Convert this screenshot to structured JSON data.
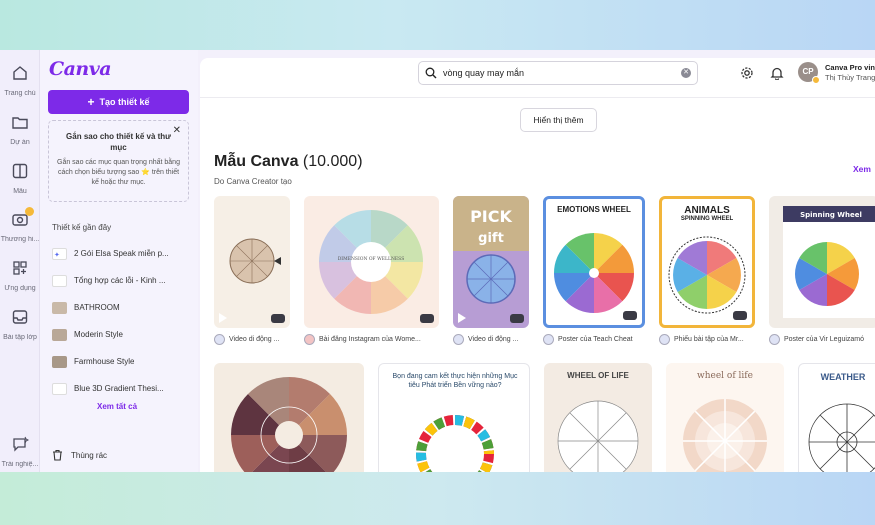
{
  "rail": [
    {
      "label": "Trang chủ",
      "icon": "home-icon"
    },
    {
      "label": "Dự án",
      "icon": "folder-icon"
    },
    {
      "label": "Mẫu",
      "icon": "template-icon"
    },
    {
      "label": "Thương hi...",
      "icon": "brand-icon"
    },
    {
      "label": "Ứng dụng",
      "icon": "apps-icon"
    },
    {
      "label": "Bài tập lớp",
      "icon": "classwork-icon"
    },
    {
      "label": "Trải nghiệ...",
      "icon": "dream-lab-icon"
    }
  ],
  "panel": {
    "logo": "Canva",
    "create_label": "Tạo thiết kế",
    "star_title": "Gắn sao cho thiết kế và thư mục",
    "star_body": "Gắn sao các mục quan trọng nhất bằng cách chọn biểu tượng sao ⭐ trên thiết kế hoặc thư mục.",
    "recent_title": "Thiết kế gần đây",
    "recent": [
      "2 Gói Elsa Speak miễn p...",
      "Tổng hợp các lỗi - Kinh ...",
      "BATHROOM",
      "Moderin Style",
      "Farmhouse Style",
      "Blue 3D Gradient Thesi..."
    ],
    "see_all": "Xem tất cả",
    "trash": "Thùng rác"
  },
  "topbar": {
    "search_value": "vòng quay may mắn",
    "account_name": "Canva Pro vin",
    "account_sub": "Thị Thùy Trang",
    "avatar_initials": "CP"
  },
  "main": {
    "show_more": "Hiển thị thêm",
    "section_title": "Mẫu Canva",
    "section_count": "(10.000)",
    "section_sub": "Do Canva Creator tạo",
    "see_more": "Xem"
  },
  "row1": [
    {
      "caption": "Video di động ..."
    },
    {
      "caption": "Bài đăng Instagram của Wome..."
    },
    {
      "caption": "Video di động ..."
    },
    {
      "caption": "Poster của Teach Cheat",
      "title": "EMOTIONS WHEEL"
    },
    {
      "caption": "Phiếu bài tập của Mr...",
      "title": "ANIMALS",
      "subtitle": "SPINNING WHEEL"
    },
    {
      "caption": "Poster của Vir Leguizamó",
      "title": "Spinning Wheel"
    }
  ],
  "card_text": {
    "wellness_center": "DIMENSION OF WELLNESS",
    "pick_text": "PICK",
    "gift_text": "gift",
    "sdg_title": "Bọn đang cam kết thực hiện những Mục tiêu Phát triển Bền vững nào?",
    "wheel_of_life": "WHEEL OF LIFE",
    "wheel_of_life2": "wheel of life",
    "weather": "WEATHER"
  }
}
